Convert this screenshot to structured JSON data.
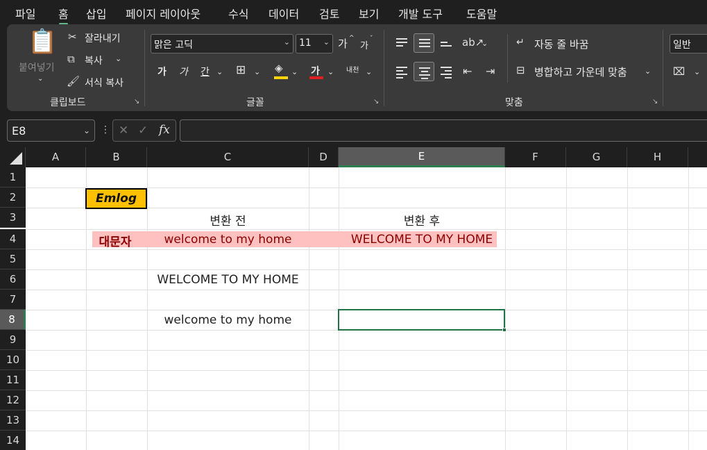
{
  "menu": {
    "tabs": [
      "파일",
      "홈",
      "삽입",
      "페이지 레이아웃",
      "수식",
      "데이터",
      "검토",
      "보기",
      "개발 도구",
      "도움말"
    ],
    "active": "홈"
  },
  "ribbon": {
    "clipboard": {
      "paste": "붙여넣기",
      "cut": "잘라내기",
      "copy": "복사",
      "format_painter": "서식 복사",
      "label": "클립보드"
    },
    "font": {
      "name": "맑은 고딕",
      "size": "11",
      "grow": "가",
      "shrink": "가",
      "bold": "가",
      "italic": "가",
      "underline": "간",
      "font_color": "가",
      "phonetic": "내천",
      "label": "글꼴"
    },
    "alignment": {
      "wrap_text": "자동 줄 바꿈",
      "merge_center": "병합하고 가운데 맞춤",
      "label": "맞춤"
    },
    "number": {
      "format": "일반"
    }
  },
  "formula_bar": {
    "name_box": "E8",
    "fx": "fx",
    "value": ""
  },
  "sheet": {
    "columns": [
      "A",
      "B",
      "C",
      "D",
      "E",
      "F",
      "G",
      "H"
    ],
    "rows": [
      "1",
      "2",
      "3",
      "4",
      "5",
      "6",
      "7",
      "8",
      "9",
      "10",
      "11",
      "12",
      "13",
      "14"
    ],
    "selected_column": "E",
    "selected_row": "8",
    "cells": {
      "B2": "Emlog",
      "C3": "변환 전",
      "E3": "변환 후",
      "B4": "대문자",
      "C4": "welcome to my home",
      "E4": "WELCOME TO MY HOME",
      "C6": "WELCOME TO MY HOME",
      "C8": "welcome to my home"
    },
    "colors": {
      "emlog_fill": "#ffc000",
      "highlight_fill": "#ffc0c0",
      "selection": "#217346"
    }
  }
}
